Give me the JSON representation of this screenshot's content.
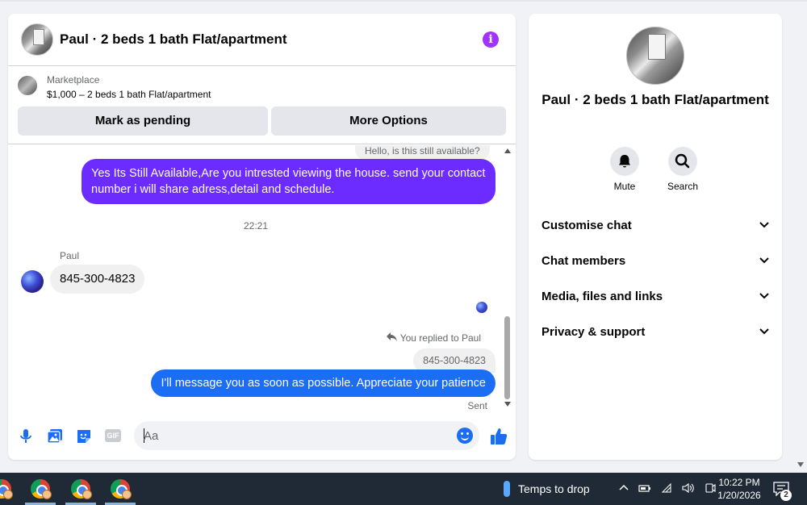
{
  "chat": {
    "title": "Paul · 2 beds 1 bath Flat/apartment",
    "marketplace_label": "Marketplace",
    "listing": "$1,000 – 2 beds 1 bath Flat/apartment",
    "mark_pending_label": "Mark as pending",
    "more_options_label": "More Options"
  },
  "messages": {
    "first_sent_quote": "Hello, is this still available?",
    "reply_purple": "Yes Its Still Available,Are you intrested viewing the house. send your contact number i will share adress,detail and schedule.",
    "timestamp": "22:21",
    "sender_name": "Paul",
    "incoming": "845-300-4823",
    "replied_to": "You replied to Paul",
    "quoted": "845-300-4823",
    "reply_blue": "I'll message you as soon as possible. Appreciate your patience",
    "status": "Sent"
  },
  "composer": {
    "placeholder": "Aa"
  },
  "side": {
    "name": "Paul · 2 beds 1 bath Flat/apartment",
    "mute_label": "Mute",
    "search_label": "Search",
    "rows": [
      "Customise chat",
      "Chat members",
      "Media, files and links",
      "Privacy & support"
    ]
  },
  "taskbar": {
    "weather": "Temps to drop",
    "time": "10:22 PM",
    "date": "1/20/2026",
    "notifications": "2"
  },
  "colors": {
    "purple_bubble": "#6c2bff",
    "blue_bubble": "#1b6ef3",
    "info_icon": "#a033ff",
    "taskbar": "#1f2a36"
  }
}
